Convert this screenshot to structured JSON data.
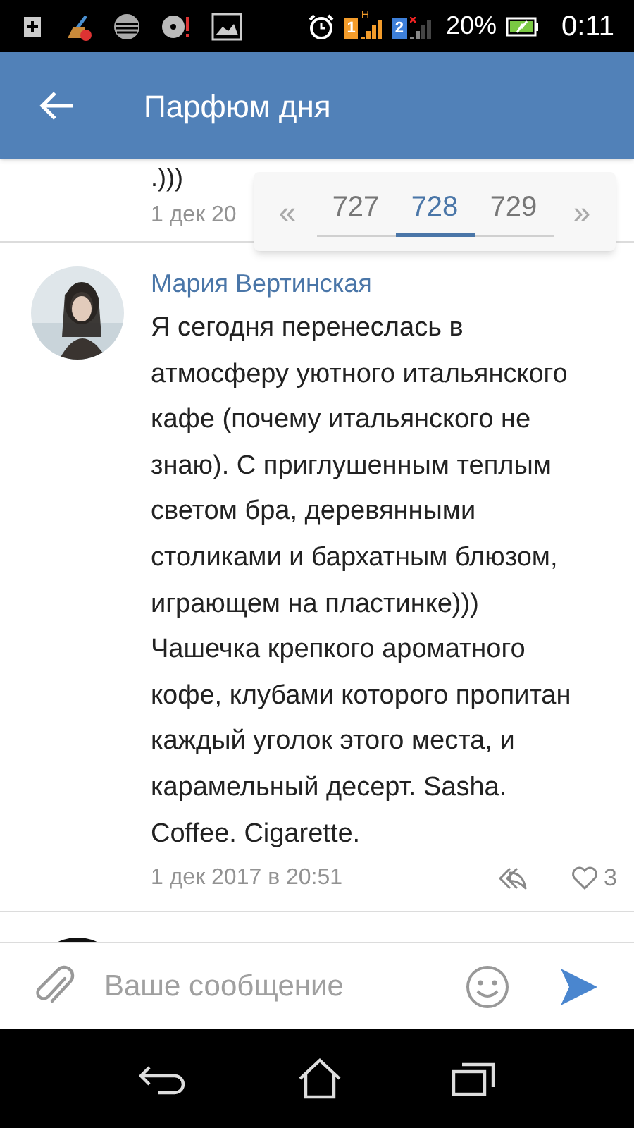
{
  "status_bar": {
    "sims": [
      {
        "label": "1",
        "network": "H",
        "color": "#f39c2b"
      },
      {
        "label": "2",
        "color": "#3d7fd9"
      }
    ],
    "battery": "20%",
    "time": "0:11"
  },
  "header": {
    "title": "Парфюм дня"
  },
  "pager": {
    "prev": "«",
    "next": "»",
    "pages": [
      {
        "label": "727",
        "selected": false
      },
      {
        "label": "728",
        "selected": true
      },
      {
        "label": "729",
        "selected": false
      }
    ]
  },
  "comments": [
    {
      "kind": "partial",
      "text": ".)))",
      "date": "1 дек 20"
    },
    {
      "kind": "full",
      "author": "Мария Вертинская",
      "text": "Я сегодня перенеслась в атмосферу уютного итальянского кафе (почему итальянского не знаю). С приглушенным теплым светом бра, деревянными столиками и бархатным блюзом, играющем на пластинке))) Чашечка крепкого ароматного кофе, клубами которого пропитан каждый уголок этого места, и карамельный десерт. Sasha. Coffee. Cigarette.",
      "date": "1 дек 2017 в 20:51",
      "likes": "3"
    },
    {
      "kind": "cut"
    }
  ],
  "composer": {
    "placeholder": "Ваше сообщение"
  }
}
